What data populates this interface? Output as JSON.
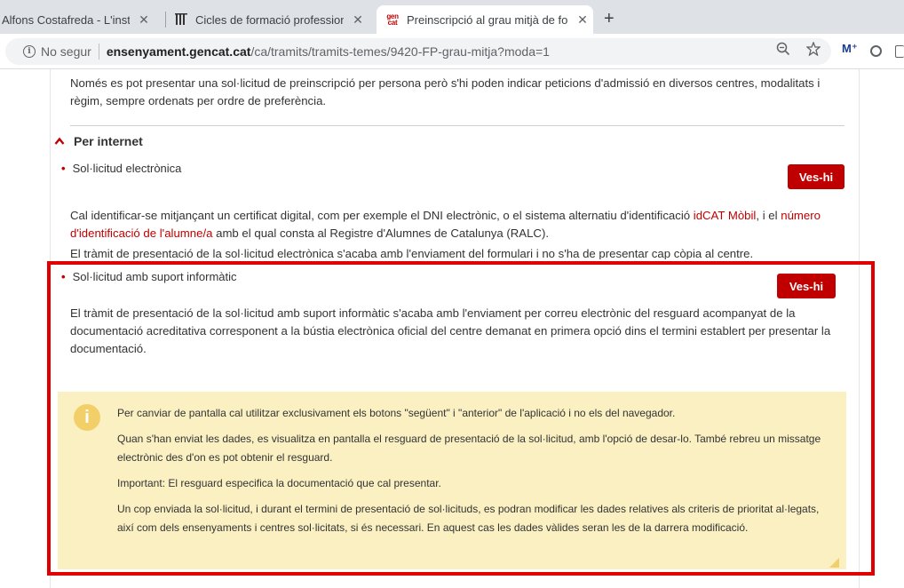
{
  "browser": {
    "tabs": [
      {
        "title": "Alfons Costafreda - L'institut",
        "close": "✕"
      },
      {
        "title": "Cicles de formació professional",
        "close": "✕"
      },
      {
        "title": "Preinscripció al grau mitjà de formació professional",
        "close": "✕",
        "favicon_text": "gen cat"
      }
    ],
    "new_tab": "+",
    "info_icon": "i",
    "security_label": "No segur",
    "url_host": "ensenyament.gencat.cat",
    "url_path": "/ca/tramits/tramits-temes/9420-FP-grau-mitja?moda=1",
    "extension_label": "M⁺",
    "icons": [
      "info-icon",
      "zoom-icon",
      "star-icon",
      "extension-m-icon",
      "extension-circle-icon"
    ]
  },
  "content": {
    "intro": "Només es pot presentar una sol·licitud de preinscripció per persona però s'hi poden indicar peticions d'admissió en diversos centres, modalitats i règim, sempre ordenats per ordre de preferència.",
    "section_title": "Per internet",
    "items": [
      {
        "bullet": "•",
        "label": "Sol·licitud electrònica",
        "button": "Ves-hi",
        "p1_before": "Cal identificar-se mitjançant un certificat digital, com per exemple el DNI electrònic, o el sistema alternatiu d'identificació ",
        "p1_link1": "idCAT Mòbil",
        "p1_middle": ", i el ",
        "p1_link2": "número d'identificació de l'alumne/a",
        "p1_after": " amb el qual consta al Registre d'Alumnes de Catalunya (RALC).",
        "p2": "El tràmit de presentació de la sol·licitud electrònica s'acaba amb l'enviament del formulari i no s'ha de presentar cap còpia al centre."
      },
      {
        "bullet": "•",
        "label": "Sol·licitud amb suport informàtic",
        "button": "Ves-hi",
        "p1": "El tràmit de presentació de la sol·licitud amb suport informàtic s'acaba amb l'enviament per correu electrònic del resguard acompanyat de la documentació acreditativa corresponent a la bústia electrònica oficial del centre demanat en primera opció dins el termini establert per presentar la documentació."
      }
    ],
    "note": {
      "icon": "i",
      "paragraphs": [
        "Per canviar de pantalla cal utilitzar exclusivament els botons \"següent\" i \"anterior\" de l'aplicació i no els del navegador.",
        "Quan s'han enviat les dades, es visualitza en pantalla el resguard de presentació de la sol·licitud, amb l'opció de desar-lo. També rebreu un missatge electrònic des d'on es pot obtenir el resguard.",
        "Important: El resguard especifica la documentació que cal presentar.",
        "Un cop enviada la sol·licitud, i durant el termini de presentació de sol·licituds, es podran modificar les dades relatives als criteris de prioritat al·legats, així com dels ensenyaments i centres sol·licitats, si és necessari. En aquest cas les dades vàlides seran les de la darrera modificació."
      ]
    }
  },
  "colors": {
    "accent": "#c00000",
    "note_bg": "#faf0c2",
    "note_icon": "#f3cf69",
    "highlight": "#e00000"
  }
}
